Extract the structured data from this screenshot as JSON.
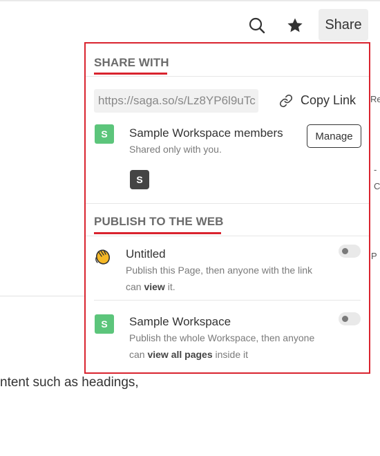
{
  "toolbar": {
    "share_label": "Share"
  },
  "background": {
    "right_glyphs": [
      "Re",
      "-",
      "C",
      "P"
    ],
    "body_text": "ntent such as headings,"
  },
  "share_panel": {
    "share_with": {
      "title": "SHARE WITH",
      "link_url": "https://saga.so/s/Lz8YP6l9uTc",
      "copy_link_label": "Copy Link",
      "members": {
        "badge": "S",
        "name": "Sample Workspace members",
        "subtitle": "Shared only with you.",
        "manage_label": "Manage",
        "avatar_letter": "S"
      }
    },
    "publish": {
      "title": "PUBLISH TO THE WEB",
      "items": [
        {
          "name": "Untitled",
          "desc_pre": "Publish this Page, then anyone with the link can ",
          "desc_bold": "view",
          "desc_post": " it.",
          "icon": "waving-hand-icon",
          "enabled": false
        },
        {
          "badge": "S",
          "name": "Sample Workspace",
          "desc_pre": "Publish the whole Workspace, then anyone can ",
          "desc_bold": "view all pages",
          "desc_post": " inside it",
          "enabled": false
        }
      ]
    }
  },
  "colors": {
    "accent_red": "#d9232e",
    "workspace_green": "#5cc57b"
  }
}
